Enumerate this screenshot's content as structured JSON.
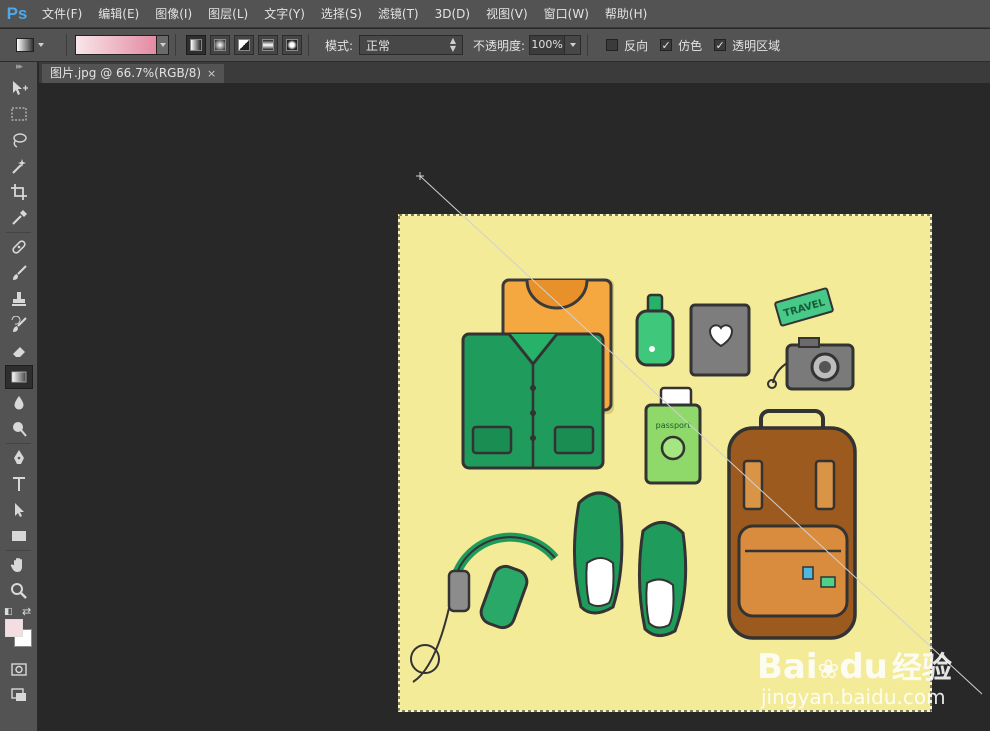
{
  "app": {
    "logo": "Ps"
  },
  "menu": [
    "文件(F)",
    "编辑(E)",
    "图像(I)",
    "图层(L)",
    "文字(Y)",
    "选择(S)",
    "滤镜(T)",
    "3D(D)",
    "视图(V)",
    "窗口(W)",
    "帮助(H)"
  ],
  "options": {
    "mode_label": "模式:",
    "mode_value": "正常",
    "opacity_label": "不透明度:",
    "opacity_value": "100%",
    "reverse_label": "反向",
    "reverse_checked": false,
    "dither_label": "仿色",
    "dither_checked": true,
    "transparency_label": "透明区域",
    "transparency_checked": true,
    "check_mark": "✓"
  },
  "document": {
    "tab_title": "图片.jpg @ 66.7%(RGB/8)",
    "close_glyph": "×"
  },
  "canvas_art": {
    "travel_tag": "TRAVEL",
    "passport_text": "passport"
  },
  "colors": {
    "foreground": "#f5dee2",
    "background": "#ffffff",
    "canvas_bg": "#f3eb98"
  },
  "watermark": {
    "brand": "Bai",
    "brand_after": "du",
    "site_cn": "经验",
    "url": "jingyan.baidu.com"
  }
}
